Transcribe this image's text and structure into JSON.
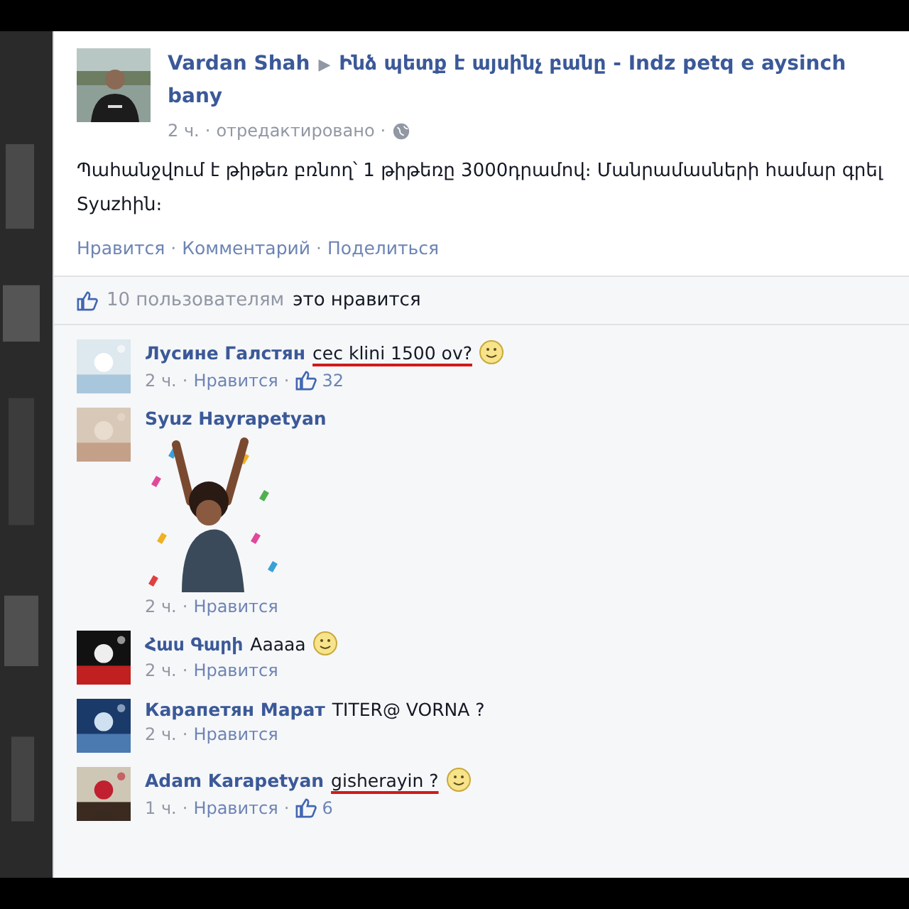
{
  "post": {
    "author": "Vardan Shah",
    "arrow": "▶",
    "group": "Ինձ պետք է այսինչ բանը - Indz petq e aysinch bany",
    "time": "2 ч.",
    "separator": "·",
    "edited": "отредактировано",
    "body": "Պահանջվում է թիթեռ բռնող՝ 1 թիթեռը 3000դրամով։ Մանրամասների համար գրել Syuzhին։",
    "actions": [
      "Нравится",
      "Комментарий",
      "Поделиться"
    ]
  },
  "likes": {
    "count": "10 пользователям",
    "rest": "это нравится"
  },
  "comments": [
    {
      "author": "Лусине Галстян",
      "text": "cec klini 1500 ov?",
      "underlined": true,
      "smiley": true,
      "sticker": false,
      "time": "2 ч.",
      "like_label": "Нравится",
      "likes": "32"
    },
    {
      "author": "Syuz Hayrapetyan",
      "sticker": true,
      "underlined": false,
      "smiley": false,
      "time": "2 ч.",
      "like_label": "Нравится"
    },
    {
      "author": "Հաս Գարի",
      "text": "Aaaaa",
      "underlined": false,
      "smiley": true,
      "sticker": false,
      "time": "2 ч.",
      "like_label": "Нравится"
    },
    {
      "author": "Карапетян Марат",
      "text": "TITER@ VORNA ?",
      "underlined": false,
      "smiley": false,
      "sticker": false,
      "time": "2 ч.",
      "like_label": "Нравится"
    },
    {
      "author": "Adam Karapetyan",
      "text": "gisherayin ?",
      "underlined": true,
      "smiley": true,
      "sticker": false,
      "time": "1 ч.",
      "like_label": "Нравится",
      "likes": "6"
    }
  ]
}
